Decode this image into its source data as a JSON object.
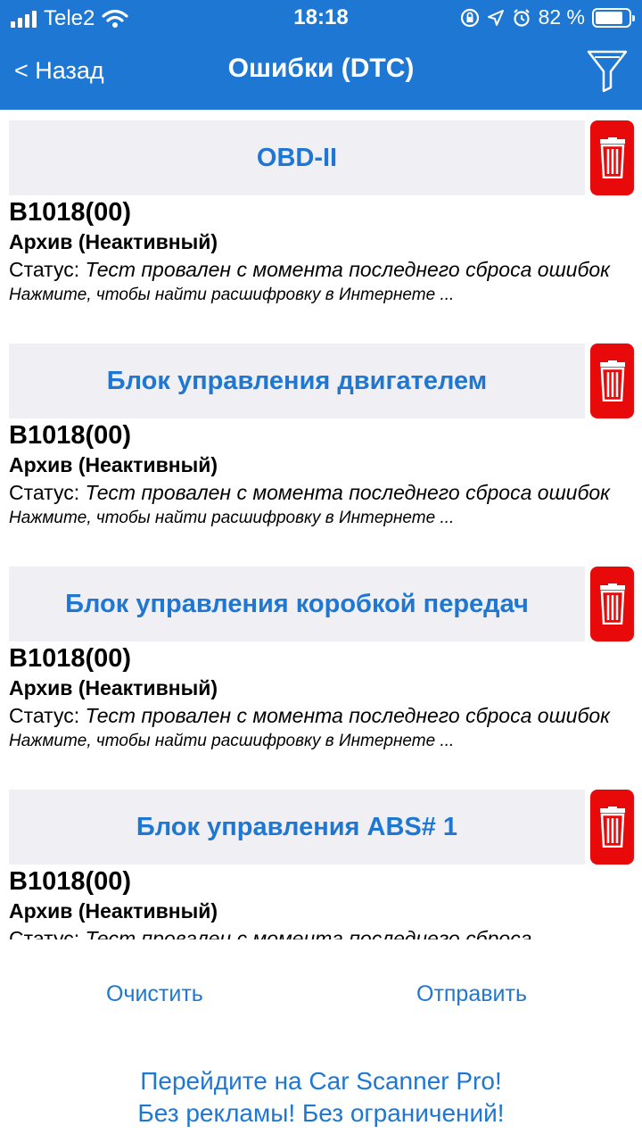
{
  "statusbar": {
    "carrier": "Tele2",
    "time": "18:18",
    "battery_percent": "82 %",
    "battery_level": 0.82
  },
  "navbar": {
    "back_label": "< Назад",
    "title": "Ошибки (DTC)"
  },
  "sections": [
    {
      "title": "OBD-II",
      "code": "B1018(00)",
      "archive": "Архив (Неактивный)",
      "status_prefix": "Статус:",
      "status_text": "Тест провален с момента последнего сброса ошибок",
      "hint": "Нажмите, чтобы найти расшифровку в Интернете ..."
    },
    {
      "title": "Блок управления двигателем",
      "code": "B1018(00)",
      "archive": "Архив (Неактивный)",
      "status_prefix": "Статус:",
      "status_text": "Тест провален с момента последнего сброса ошибок",
      "hint": "Нажмите, чтобы найти расшифровку в Интернете ..."
    },
    {
      "title": "Блок управления коробкой передач",
      "code": "B1018(00)",
      "archive": "Архив (Неактивный)",
      "status_prefix": "Статус:",
      "status_text": "Тест провален с момента последнего сброса ошибок",
      "hint": "Нажмите, чтобы найти расшифровку в Интернете ..."
    },
    {
      "title": "Блок управления ABS# 1",
      "code": "B1018(00)",
      "archive": "Архив (Неактивный)",
      "status_prefix": "Статус:",
      "status_text": "Тест провален с момента последнего сброса"
    }
  ],
  "actions": {
    "clear_label": "Очистить",
    "send_label": "Отправить"
  },
  "promo": {
    "line1": "Перейдите на Car Scanner Pro!",
    "line2": "Без рекламы! Без ограничений!"
  },
  "icons": {
    "back": "chevron-left-icon",
    "filter": "filter-icon",
    "trash": "trash-icon"
  },
  "colors": {
    "accent": "#1E77D3",
    "header_bg": "#EFEFF4",
    "delete": "#E80A0A"
  }
}
